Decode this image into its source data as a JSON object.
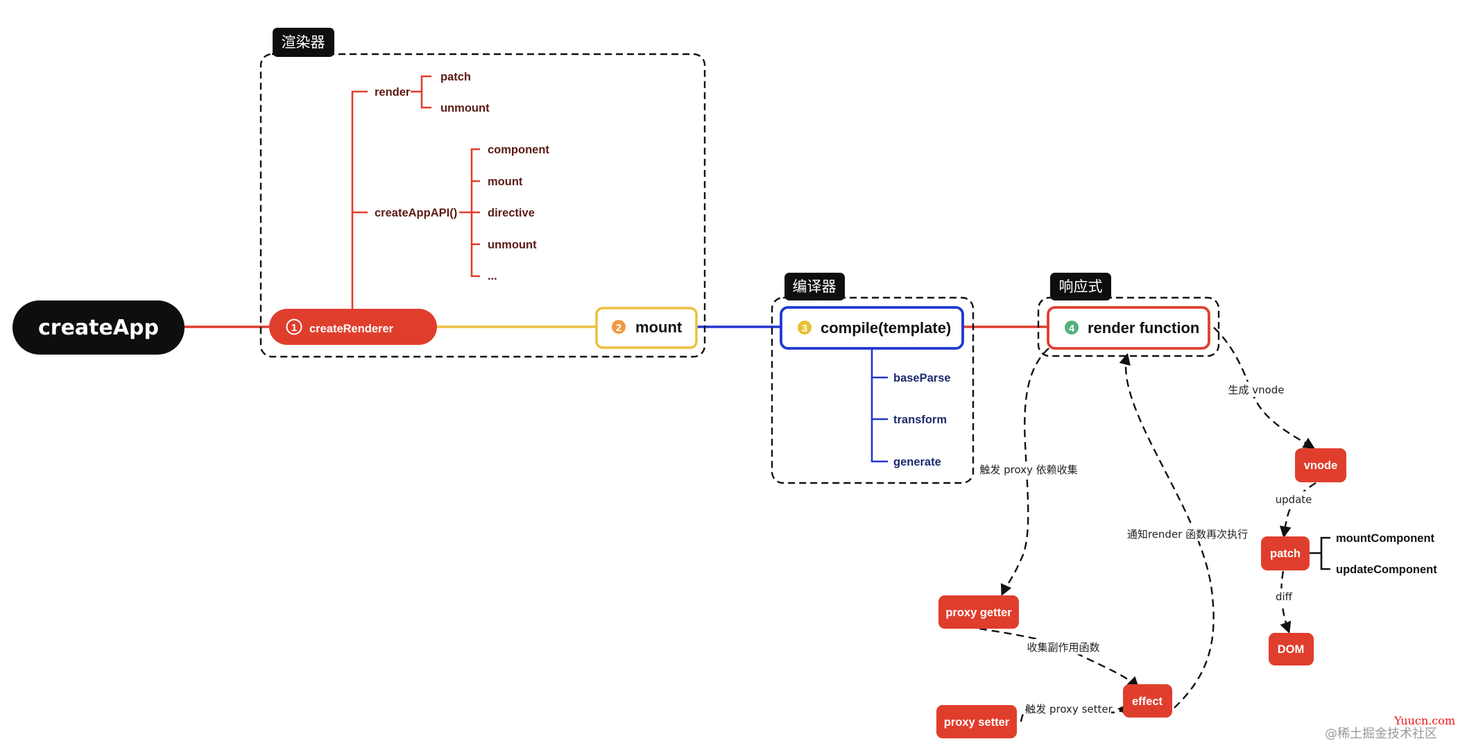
{
  "colors": {
    "red": "#e03e2d",
    "yellow": "#ecbf3f",
    "blue": "#2136d1",
    "black": "#0e0e0e",
    "orange_badge": "#ef9a45",
    "yellow_badge": "#eac031",
    "green_badge": "#52b07a",
    "tree_text": "#5b1b14",
    "compiler_text": "#1a2a6e"
  },
  "root": {
    "label": "createApp"
  },
  "groups": {
    "renderer": {
      "title": "渲染器"
    },
    "compiler": {
      "title": "编译器"
    },
    "reactive": {
      "title": "响应式"
    }
  },
  "steps": [
    {
      "number": "1",
      "label": "createRenderer"
    },
    {
      "number": "2",
      "label": "mount"
    },
    {
      "number": "3",
      "label": "compile(template)"
    },
    {
      "number": "4",
      "label": "render function"
    }
  ],
  "renderer_tree": {
    "render": {
      "label": "render",
      "children": [
        "patch",
        "unmount"
      ]
    },
    "createAppAPI": {
      "label": "createAppAPI()",
      "children": [
        "component",
        "mount",
        "directive",
        "unmount",
        "..."
      ]
    }
  },
  "compiler_tree": {
    "children": [
      "baseParse",
      "transform",
      "generate"
    ]
  },
  "reactive_nodes": {
    "vnode": "vnode",
    "patch": "patch",
    "dom": "DOM",
    "proxy_getter": "proxy getter",
    "proxy_setter": "proxy setter",
    "effect": "effect"
  },
  "patch_children": [
    "mountComponent",
    "updateComponent"
  ],
  "edge_labels": {
    "gen_vnode": "生成 vnode",
    "update": "update",
    "diff": "diff",
    "trigger_collect": "触发 proxy 依赖收集",
    "notify_render": "通知render 函数再次执行",
    "collect_effect": "收集副作用函数",
    "trigger_setter": "触发 proxy setter"
  },
  "watermark": {
    "site": "Yuucn.com",
    "credit": "@稀土掘金技术社区"
  }
}
